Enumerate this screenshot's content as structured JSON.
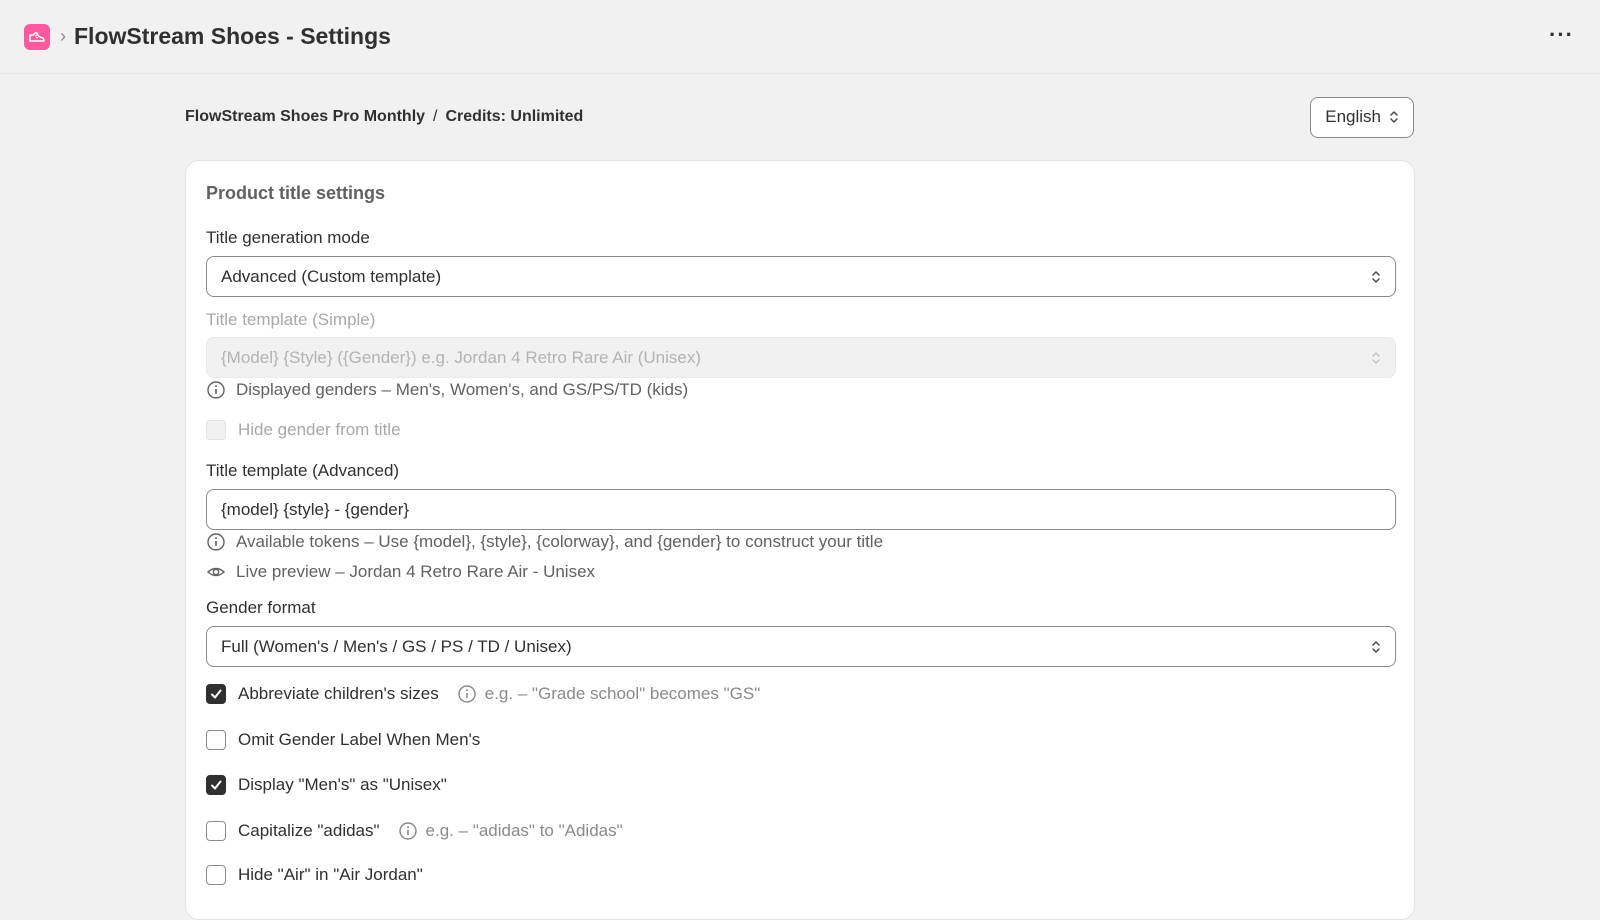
{
  "header": {
    "title": "FlowStream Shoes - Settings",
    "app_icon": "shoe-icon",
    "more": "···"
  },
  "plan": {
    "name": "FlowStream Shoes Pro Monthly",
    "separator": "/",
    "credits": "Credits: Unlimited"
  },
  "language": {
    "value": "English"
  },
  "card": {
    "title": "Product title settings",
    "mode_label": "Title generation mode",
    "mode_value": "Advanced (Custom template)",
    "simple_label": "Title template (Simple)",
    "simple_value": "{Model} {Style} ({Gender}) e.g. Jordan 4 Retro Rare Air (Unisex)",
    "simple_help": "Displayed genders – Men's, Women's, and GS/PS/TD (kids)",
    "hide_gender_label": "Hide gender from title",
    "advanced_label": "Title template (Advanced)",
    "advanced_value": "{model} {style} - {gender}",
    "tokens_help": "Available tokens – Use {model}, {style}, {colorway}, and {gender} to construct your title",
    "preview_help": "Live preview – Jordan 4 Retro Rare Air - Unisex",
    "gender_format_label": "Gender format",
    "gender_format_value": "Full (Women's / Men's / GS / PS / TD / Unisex)",
    "options": [
      {
        "label": "Abbreviate children's sizes",
        "checked": true,
        "hint": "e.g. – \"Grade school\" becomes \"GS\""
      },
      {
        "label": "Omit Gender Label When Men's",
        "checked": false
      },
      {
        "label": "Display \"Men's\" as \"Unisex\"",
        "checked": true
      },
      {
        "label": "Capitalize \"adidas\"",
        "checked": false,
        "hint": "e.g. – \"adidas\" to \"Adidas\""
      },
      {
        "label": "Hide \"Air\" in \"Air Jordan\"",
        "checked": false
      }
    ]
  },
  "colors": {
    "accent": "#ff5aa0",
    "checked": "#303030",
    "background": "#f1f1f1"
  }
}
